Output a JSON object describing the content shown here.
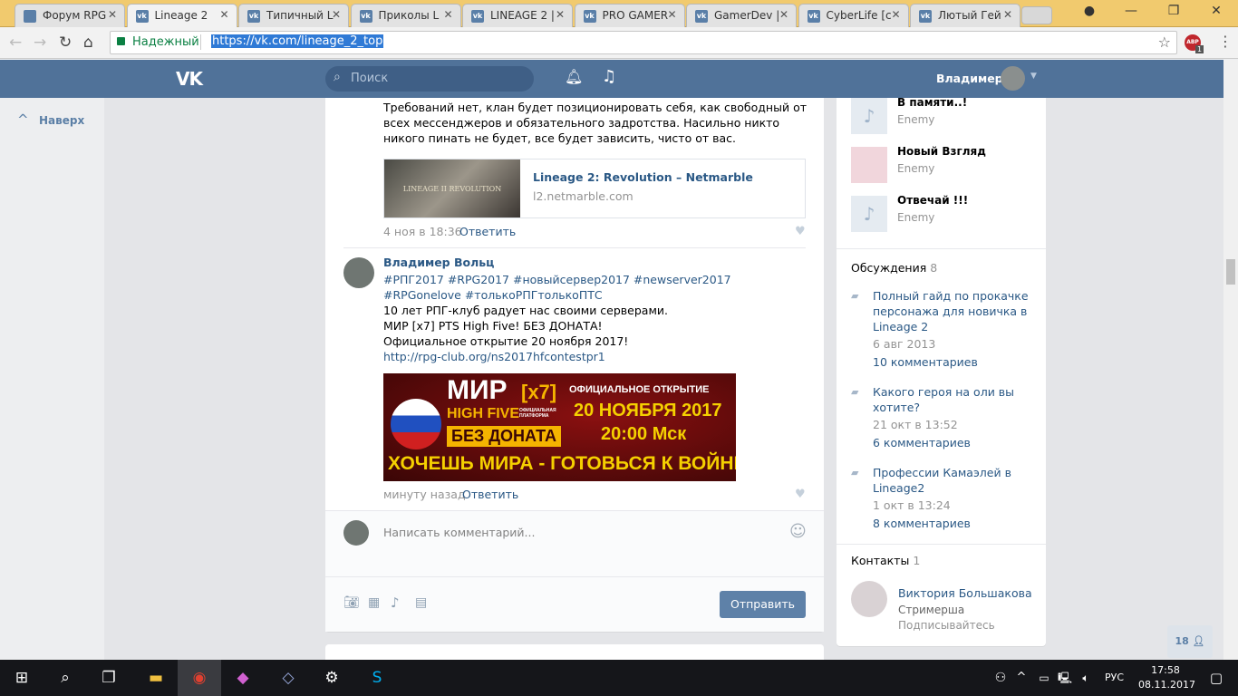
{
  "browser": {
    "tabs": [
      {
        "title": "Форум RPG",
        "active": false
      },
      {
        "title": "Lineage 2",
        "active": true
      },
      {
        "title": "Типичный L",
        "active": false
      },
      {
        "title": "Приколы L",
        "active": false
      },
      {
        "title": "LINEAGE 2 |",
        "active": false
      },
      {
        "title": "PRO GAMER",
        "active": false
      },
      {
        "title": "GamerDev |",
        "active": false
      },
      {
        "title": "CyberLife [c",
        "active": false
      },
      {
        "title": "Лютый Гей",
        "active": false
      }
    ],
    "secure_label": "Надежный",
    "url": "https://vk.com/lineage_2_top",
    "abp_badge": "1"
  },
  "header": {
    "search_placeholder": "Поиск",
    "user_name": "Владимер"
  },
  "left": {
    "back_to_top": "Наверх"
  },
  "post1": {
    "text": "Требований нет, клан будет позиционировать себя, как свободный от всех мессенджеров и обязательного задротства. Насильно никто никого пинать не будет, все будет зависить, чисто от вас.",
    "link_title": "Lineage 2: Revolution – Netmarble",
    "link_domain": "l2.netmarble.com",
    "link_thumb_text": "LINEAGE II REVOLUTION",
    "date": "4 ноя в 18:36",
    "reply": "Ответить"
  },
  "post2": {
    "author": "Владимер Вольц",
    "hashtags": "#РПГ2017 #RPG2017 #новыйсервер2017 #newserver2017 #RPGonelove #толькоРПГтолькоПТС",
    "lines": [
      "10 лет РПГ-клуб радует нас своими серверами.",
      "МИР [x7] PTS High Five! БЕЗ ДОНАТА!",
      "Официальное открытие 20 ноября 2017!"
    ],
    "url": "http://rpg-club.org/ns2017hfcontestpr1",
    "banner": {
      "mir": "МИР",
      "x7": "[x7]",
      "hf": "HIGH FIVE",
      "platform": "ОФИЦИАЛЬНАЯ ПЛАТФОРМА",
      "nodonate": "БЕЗ ДОНАТА",
      "open": "ОФИЦИАЛЬНОЕ ОТКРЫТИЕ",
      "date": "20 НОЯБРЯ 2017",
      "time": "20:00 Мск",
      "slogan": "ХОЧЕШЬ МИРА - ГОТОВЬСЯ К ВОЙНЕ"
    },
    "date": "минуту назад",
    "reply": "Ответить"
  },
  "comment": {
    "placeholder": "Написать комментарий...",
    "send": "Отправить"
  },
  "audio": [
    {
      "title": "В памяти..!",
      "artist": "Enemy"
    },
    {
      "title": "Новый Взгляд",
      "artist": "Enemy"
    },
    {
      "title": "Отвечай !!!",
      "artist": "Enemy"
    }
  ],
  "discussions": {
    "title": "Обсуждения",
    "count": "8",
    "items": [
      {
        "title": "Полный гайд по прокачке персонажа для новичка в Lineage 2",
        "date": "6 авг 2013",
        "comments": "10 комментариев"
      },
      {
        "title": "Какого героя на оли вы хотите?",
        "date": "21 окт в 13:52",
        "comments": "6 комментариев"
      },
      {
        "title": "Профессии Камаэлей в Lineage2",
        "date": "1 окт в 13:24",
        "comments": "8 комментариев"
      }
    ]
  },
  "contacts": {
    "title": "Контакты",
    "count": "1",
    "name": "Виктория Большакова",
    "role": "Стримерша",
    "note": "Подписывайтесь"
  },
  "friends_online": "18",
  "taskbar": {
    "lang": "РУС",
    "time": "17:58",
    "date": "08.11.2017"
  },
  "colors": {
    "vk_header": "#507299",
    "link": "#2a5885",
    "button": "#5e81a8"
  }
}
